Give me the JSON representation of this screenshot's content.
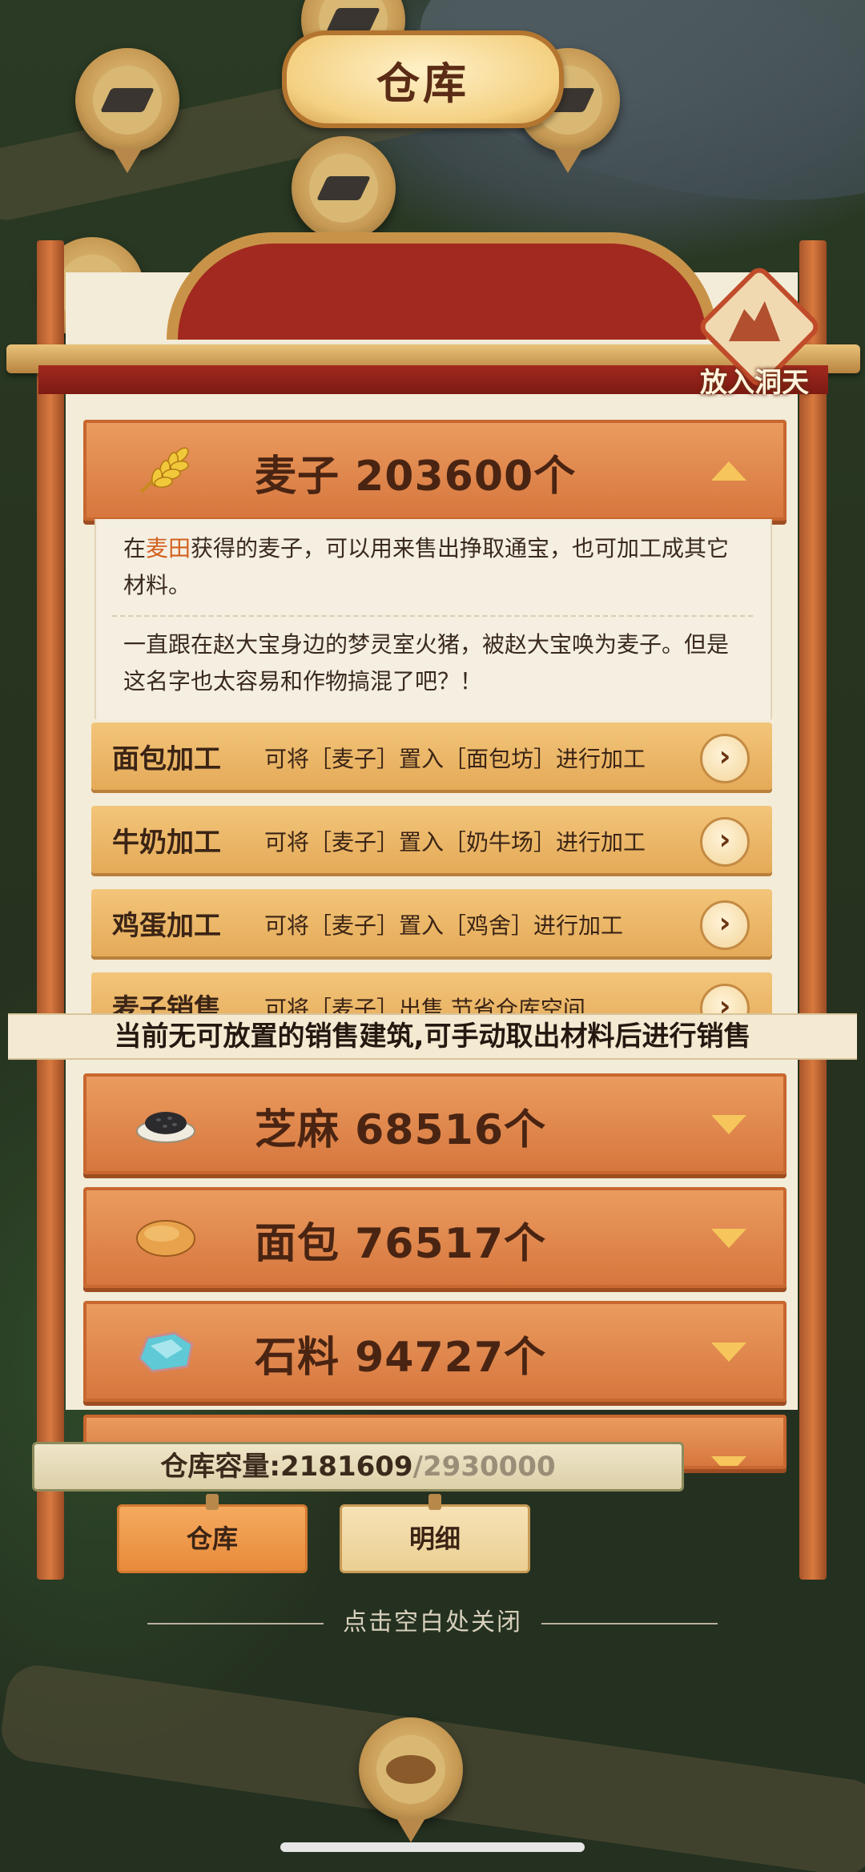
{
  "panel": {
    "title": "仓库",
    "put_in_badge": "放入洞天"
  },
  "items": [
    {
      "name": "麦子",
      "count_text": "麦子 203600个",
      "icon": "wheat-icon",
      "expanded": true,
      "description": {
        "line1_prefix": "在",
        "line1_highlight": "麦田",
        "line1_rest": "获得的麦子，可以用来售出挣取通宝，也可加工成其它材料。",
        "line2": "一直跟在赵大宝身边的梦灵室火猪，被赵大宝唤为麦子。但是这名字也太容易和作物搞混了吧？！"
      },
      "actions": [
        {
          "name": "面包加工",
          "desc": "可将［麦子］置入［面包坊］进行加工"
        },
        {
          "name": "牛奶加工",
          "desc": "可将［麦子］置入［奶牛场］进行加工"
        },
        {
          "name": "鸡蛋加工",
          "desc": "可将［麦子］置入［鸡舍］进行加工"
        },
        {
          "name": "麦子销售",
          "desc": "可将［麦子］出售,节省仓库空间"
        }
      ]
    },
    {
      "name": "芝麻",
      "count_text": "芝麻 68516个",
      "icon": "sesame-icon",
      "expanded": false
    },
    {
      "name": "面包",
      "count_text": "面包 76517个",
      "icon": "bread-icon",
      "expanded": false
    },
    {
      "name": "石料",
      "count_text": "石料 94727个",
      "icon": "stone-icon",
      "expanded": false
    }
  ],
  "toast": "当前无可放置的销售建筑,可手动取出材料后进行销售",
  "capacity": {
    "label": "仓库容量:",
    "used": "2181609",
    "max": "/2930000"
  },
  "tabs": {
    "warehouse": "仓库",
    "details": "明细"
  },
  "close_hint": "点击空白处关闭",
  "colors": {
    "accent_orange": "#d6773e",
    "highlight": "#d2601f",
    "toast_bg": "#f4ead2"
  }
}
